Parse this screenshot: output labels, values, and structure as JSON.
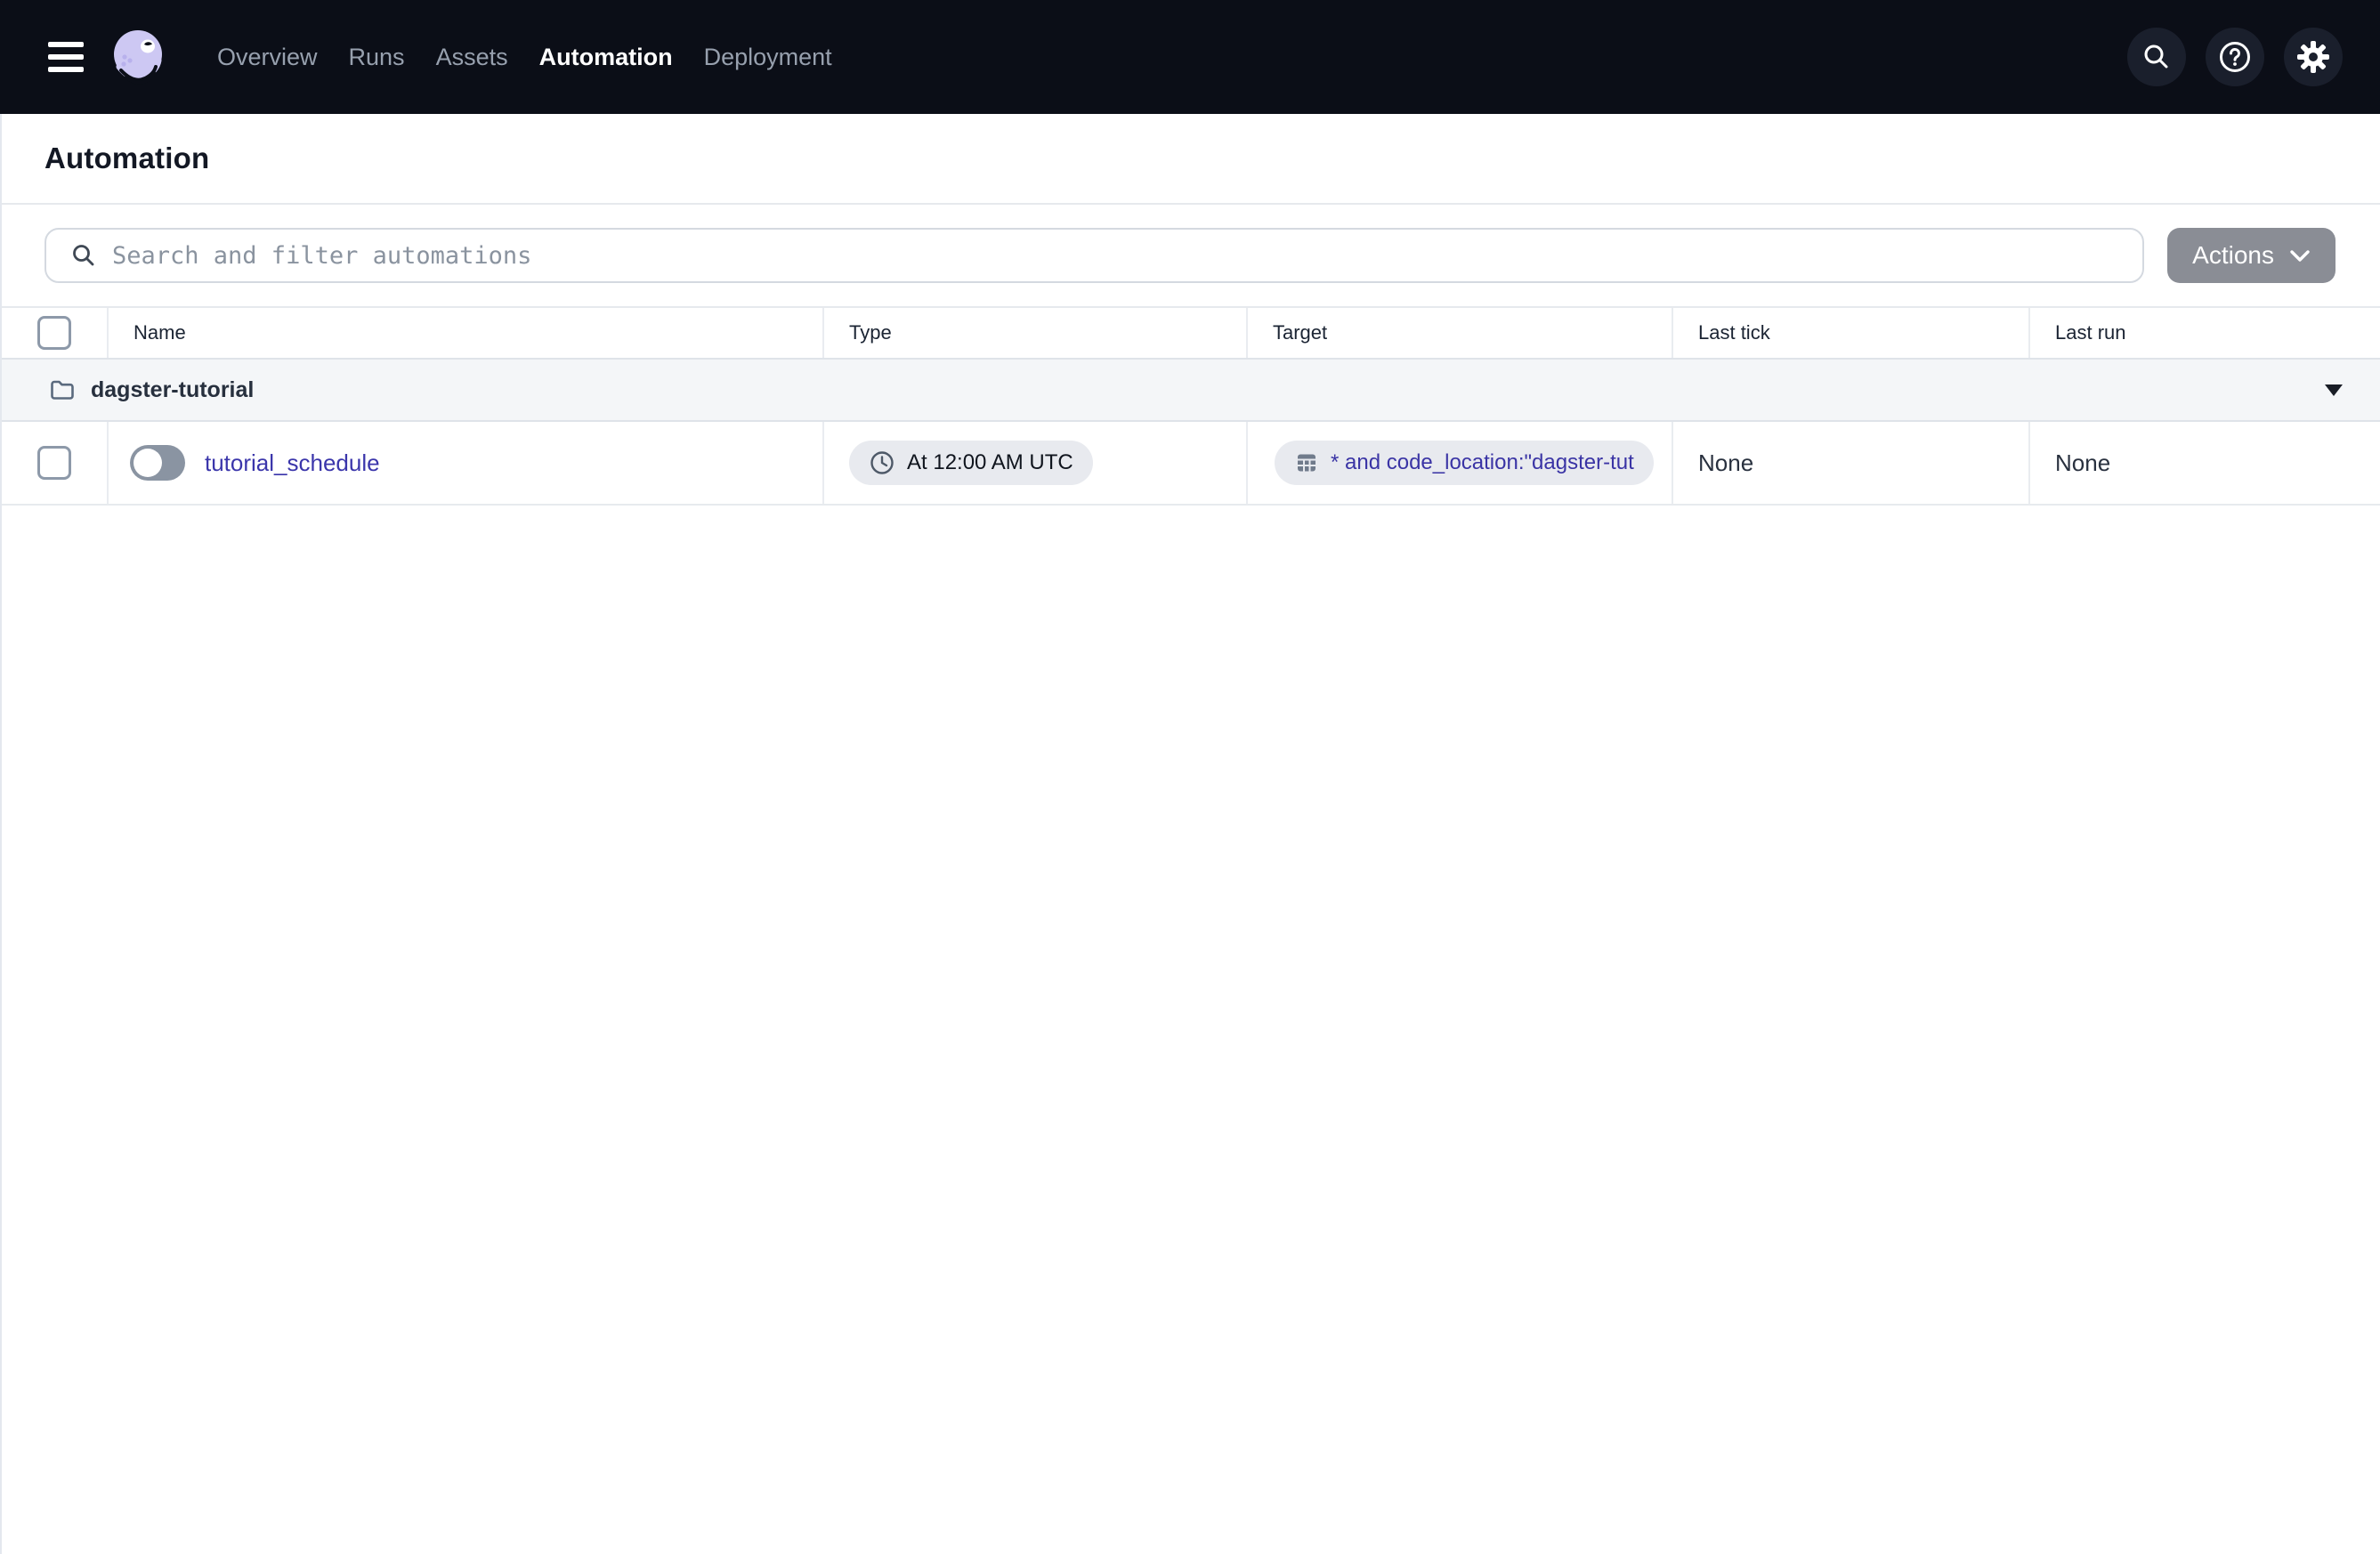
{
  "colors": {
    "navbar_bg": "#0b0e17",
    "navbar_icon_circle": "#1a1f2c",
    "logo_lavender": "#cdc8f3",
    "link_indigo": "#3b36ab",
    "pill_bg": "#e8eaef",
    "actions_button_bg": "#8a8d95",
    "group_row_bg": "#f4f6f8",
    "toggle_track": "#8a94a2"
  },
  "navbar": {
    "items": [
      {
        "label": "Overview",
        "active": false
      },
      {
        "label": "Runs",
        "active": false
      },
      {
        "label": "Assets",
        "active": false
      },
      {
        "label": "Automation",
        "active": true
      },
      {
        "label": "Deployment",
        "active": false
      }
    ],
    "icon_buttons": [
      "search-icon",
      "help-icon",
      "settings-gear-icon"
    ]
  },
  "page": {
    "title": "Automation"
  },
  "toolbar": {
    "search_placeholder": "Search and filter automations",
    "actions_label": "Actions"
  },
  "table": {
    "columns": [
      "Name",
      "Type",
      "Target",
      "Last tick",
      "Last run"
    ],
    "group": {
      "label": "dagster-tutorial"
    },
    "rows": [
      {
        "name": "tutorial_schedule",
        "enabled": false,
        "type": "At 12:00 AM UTC",
        "target": "* and code_location:\"dagster-tut",
        "last_tick": "None",
        "last_run": "None"
      }
    ]
  }
}
